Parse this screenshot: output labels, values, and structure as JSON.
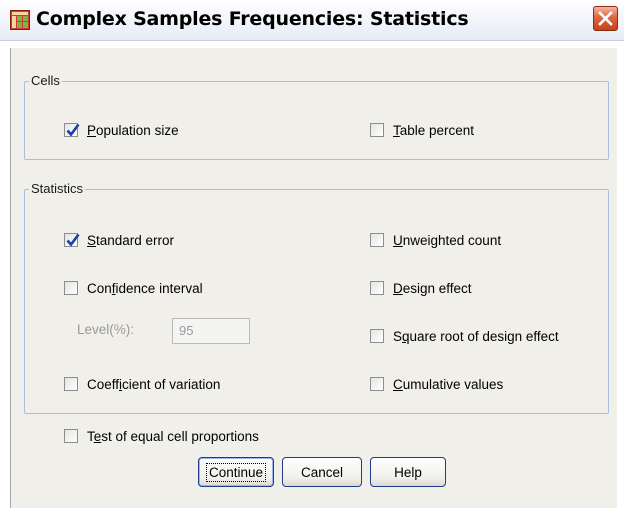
{
  "window": {
    "title": "Complex Samples Frequencies: Statistics"
  },
  "cells_group": {
    "legend": "Cells",
    "population_size": {
      "pre": "",
      "key": "P",
      "post": "opulation size",
      "checked": true
    },
    "table_percent": {
      "pre": "",
      "key": "T",
      "post": "able percent",
      "checked": false
    }
  },
  "statistics_group": {
    "legend": "Statistics",
    "standard_error": {
      "pre": "",
      "key": "S",
      "post": "tandard error",
      "checked": true
    },
    "confidence_interval": {
      "pre": "Con",
      "key": "f",
      "post": "idence interval",
      "checked": false
    },
    "level_label": "Level(%):",
    "level_value": "95",
    "coefficient_of_variation": {
      "pre": "Coeff",
      "key": "i",
      "post": "cient of variation",
      "checked": false
    },
    "unweighted_count": {
      "pre": "",
      "key": "U",
      "post": "nweighted count",
      "checked": false
    },
    "design_effect": {
      "pre": "",
      "key": "D",
      "post": "esign effect",
      "checked": false
    },
    "sqrt_design_effect": {
      "pre": "S",
      "key": "q",
      "post": "uare root of design effect",
      "checked": false
    },
    "cumulative_values": {
      "pre": "",
      "key": "C",
      "post": "umulative values",
      "checked": false
    }
  },
  "test_equal_cell_proportions": {
    "pre": "T",
    "key": "e",
    "post": "st of equal cell proportions",
    "checked": false
  },
  "buttons": {
    "continue": "Continue",
    "cancel": "Cancel",
    "help": "Help"
  },
  "colors": {
    "dialog_bg": "#f0efe9",
    "group_border": "#a8bfe0",
    "button_border": "#1f3c88",
    "close_button": "#d9552f",
    "check_mark": "#1c3fa8"
  },
  "icons": {
    "app": "spss-table-icon",
    "close": "close-x-icon",
    "check": "checkmark-icon"
  }
}
